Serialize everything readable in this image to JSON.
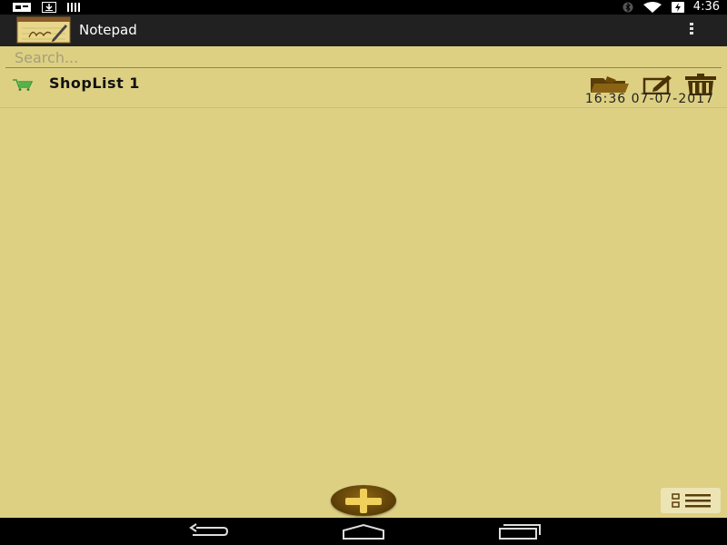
{
  "status_bar": {
    "time": "4:36",
    "icons": [
      "notification-card-icon",
      "download-icon",
      "signal-bars-icon",
      "bluetooth-icon",
      "wifi-icon",
      "battery-charging-icon"
    ]
  },
  "action_bar": {
    "title": "Notepad",
    "logo_icon": "notepad-logo-icon",
    "overflow_icon": "overflow-menu-icon"
  },
  "search": {
    "placeholder": "Search...",
    "value": ""
  },
  "notes": [
    {
      "icon": "shopping-cart-icon",
      "title": "ShopList 1",
      "timestamp": "16:36 07-07-2017",
      "actions": [
        "folder-icon",
        "edit-icon",
        "trash-icon"
      ]
    }
  ],
  "controls": {
    "add_icon": "plus-icon",
    "list_view_icon": "list-view-icon"
  },
  "colors": {
    "background": "#ddd083",
    "action_bar": "#212121",
    "accent_brown": "#5a3d07",
    "plus_yellow": "#f0cf5a"
  },
  "nav_bar": {
    "icons": [
      "back-icon",
      "home-icon",
      "recents-icon"
    ]
  }
}
